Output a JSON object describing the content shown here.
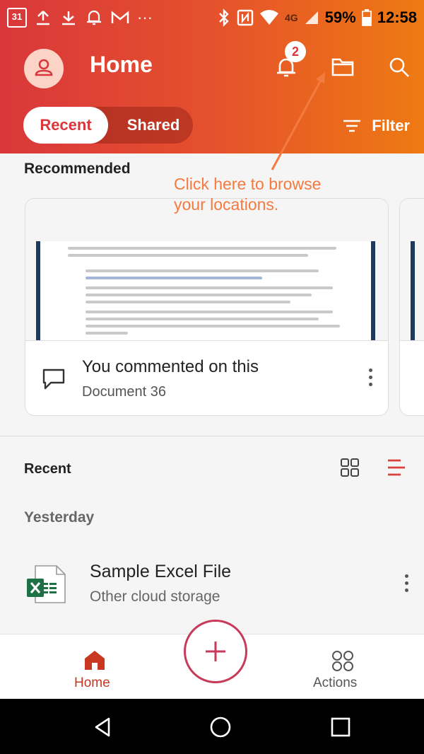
{
  "status_bar": {
    "calendar_day": "31",
    "battery": "59%",
    "time": "12:58",
    "network": "4G",
    "icons": [
      "calendar-icon",
      "upload-icon",
      "download-icon",
      "bell-icon",
      "gmail-icon",
      "more-icon",
      "bluetooth-icon",
      "nfc-icon",
      "wifi-icon",
      "signal-icon",
      "battery-icon"
    ]
  },
  "header": {
    "title": "Home",
    "notification_count": "2",
    "tabs": [
      {
        "label": "Recent",
        "selected": true
      },
      {
        "label": "Shared",
        "selected": false
      }
    ],
    "filter_label": "Filter",
    "accent_colors": [
      "#d9373b",
      "#ee7a12"
    ]
  },
  "recommended": {
    "title": "Recommended",
    "cards": [
      {
        "title": "You commented on this",
        "subtitle": "Document 36"
      }
    ]
  },
  "annotation": {
    "line1": "Click here to browse",
    "line2": "your locations.",
    "color": "#f47b40"
  },
  "recent": {
    "title": "Recent",
    "group": "Yesterday",
    "files": [
      {
        "name": "Sample Excel File",
        "location": "Other cloud storage"
      }
    ]
  },
  "bottom_nav": {
    "home": "Home",
    "actions": "Actions"
  }
}
